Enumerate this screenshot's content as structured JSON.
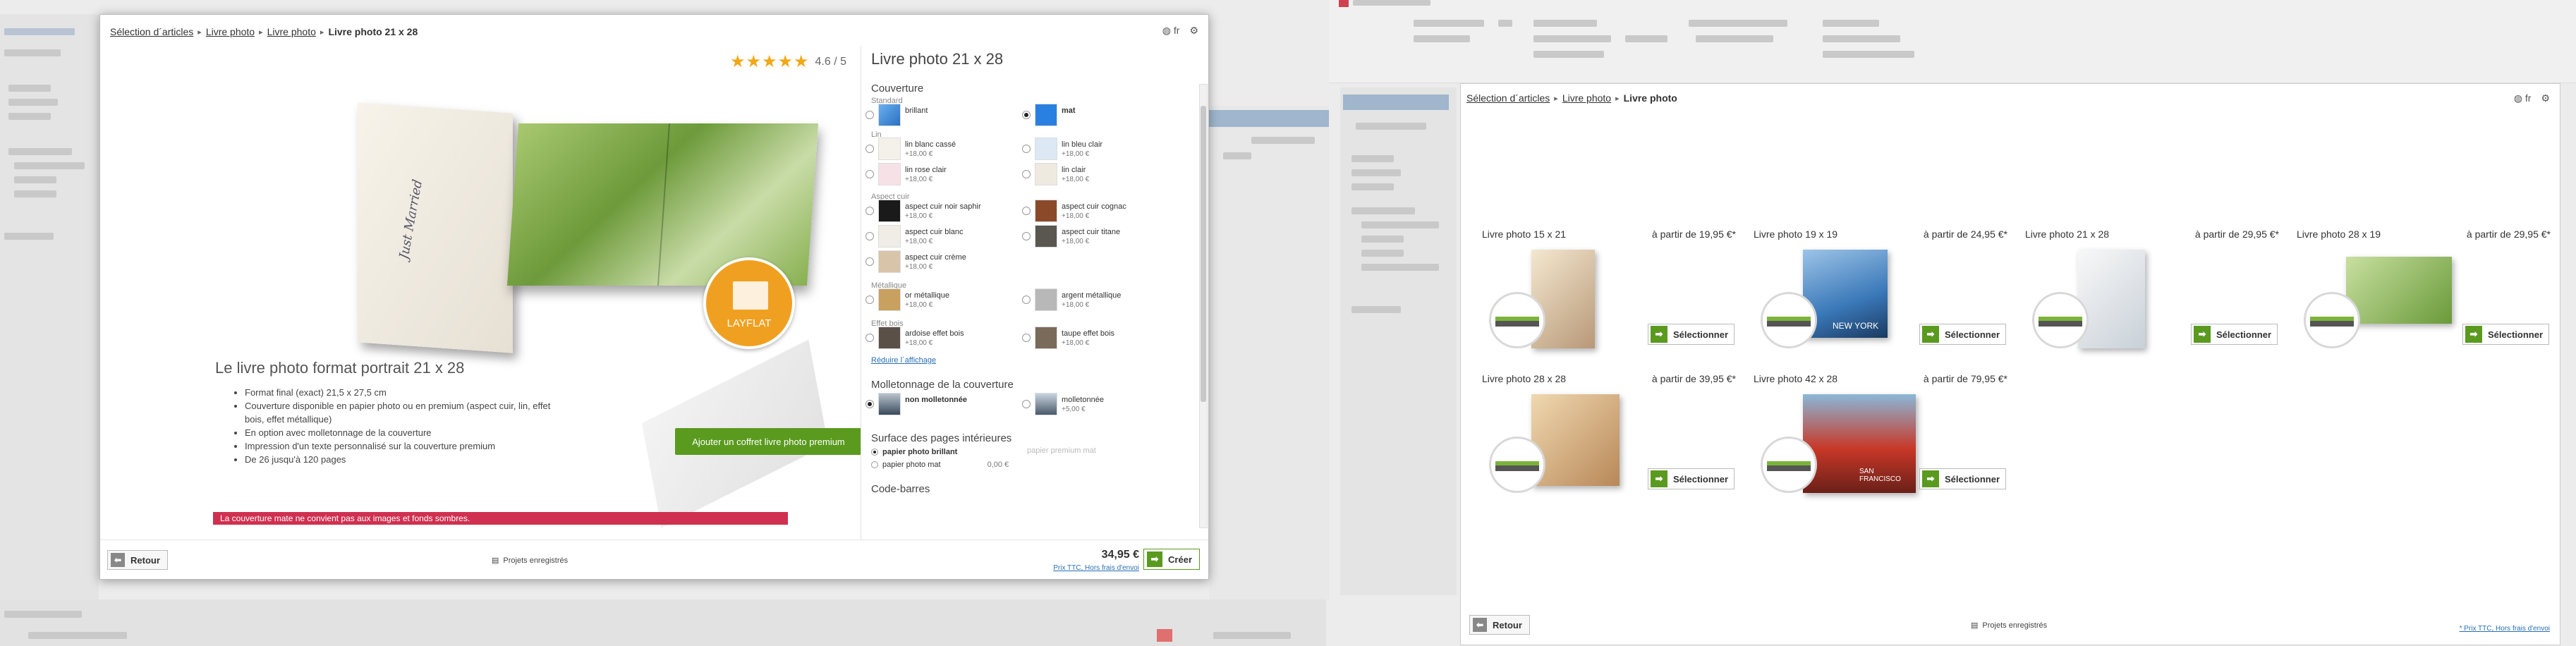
{
  "left_window": {
    "breadcrumb": [
      "Sélection d´articles",
      "Livre photo",
      "Livre photo",
      "Livre photo 21 x 28"
    ],
    "language": "fr",
    "rating": {
      "value": 4.6,
      "label": "4.6 / 5",
      "stars": "★★★★★"
    },
    "product_title": "Livre photo 21 x 28",
    "cover_script": "Just Married",
    "layflat_label": "LAYFLAT",
    "feature_title": "Le livre photo format portrait 21 x 28",
    "features": [
      "Format final  (exact) 21,5 x 27,5 cm",
      "Couverture disponible en papier photo ou en premium (aspect cuir, lin, effet bois, effet métallique)",
      "En option avec molletonnage de la couverture",
      "Impression d'un texte personnalisé sur la couverture premium",
      "De 26 jusqu'à 120 pages"
    ],
    "premium_box_button": "Ajouter un coffret livre photo premium",
    "alert": "La couverture mate ne convient pas aux images et fonds sombres.",
    "cover": {
      "title": "Couverture",
      "groups": [
        {
          "label": "Standard",
          "options": [
            {
              "name": "brillant",
              "price": "",
              "color": "#3a8ee0",
              "selected": false
            },
            {
              "name": "mat",
              "price": "",
              "color": "#2a80e0",
              "selected": true
            }
          ]
        },
        {
          "label": "Lin",
          "options": [
            {
              "name": "lin blanc cassé",
              "price": "+18,00 €",
              "color": "#f4f0ea",
              "selected": false
            },
            {
              "name": "lin bleu clair",
              "price": "+18,00 €",
              "color": "#dce8f4",
              "selected": false
            },
            {
              "name": "lin rose clair",
              "price": "+18,00 €",
              "color": "#f6e2e6",
              "selected": false
            },
            {
              "name": "lin clair",
              "price": "+18,00 €",
              "color": "#efeae0",
              "selected": false
            }
          ]
        },
        {
          "label": "Aspect cuir",
          "options": [
            {
              "name": "aspect cuir noir saphir",
              "price": "+18,00 €",
              "color": "#1a1a1a",
              "selected": false
            },
            {
              "name": "aspect cuir cognac",
              "price": "+18,00 €",
              "color": "#8a4a2a",
              "selected": false
            },
            {
              "name": "aspect cuir blanc",
              "price": "+18,00 €",
              "color": "#f0ece6",
              "selected": false
            },
            {
              "name": "aspect cuir titane",
              "price": "+18,00 €",
              "color": "#5a5650",
              "selected": false
            },
            {
              "name": "aspect cuir crème",
              "price": "+18,00 €",
              "color": "#d8c4a8",
              "selected": false
            }
          ]
        },
        {
          "label": "Métallique",
          "options": [
            {
              "name": "or métallique",
              "price": "+18,00 €",
              "color": "#c8a060",
              "selected": false
            },
            {
              "name": "argent métallique",
              "price": "+18,00 €",
              "color": "#b8b8b8",
              "selected": false
            }
          ]
        },
        {
          "label": "Effet bois",
          "options": [
            {
              "name": "ardoise effet bois",
              "price": "+18,00 €",
              "color": "#5a5048",
              "selected": false
            },
            {
              "name": "taupe effet bois",
              "price": "+18,00 €",
              "color": "#7a6a5a",
              "selected": false
            }
          ]
        }
      ],
      "reduce_link": "Réduire l´affichage"
    },
    "padding": {
      "title": "Molletonnage de la couverture",
      "options": [
        {
          "name": "non molletonnée",
          "price": "",
          "selected": true
        },
        {
          "name": "molletonnée",
          "price": "+5,00 €",
          "selected": false
        }
      ]
    },
    "pages": {
      "title": "Surface des pages intérieures",
      "options": [
        {
          "name": "papier photo brillant",
          "price": "",
          "selected": true
        },
        {
          "name": "papier photo mat",
          "price": "0,00 €",
          "selected": false
        },
        {
          "name": "papier premium mat",
          "price": "",
          "selected": false
        }
      ]
    },
    "barcode_title": "Code-barres",
    "footer": {
      "back": "Retour",
      "saved_projects": "Projets enregistrés",
      "total": "34,95 €",
      "price_note": "Prix TTC, Hors frais d'envoi",
      "create": "Créer"
    }
  },
  "right_window": {
    "breadcrumb": [
      "Sélection d´articles",
      "Livre photo",
      "Livre photo"
    ],
    "language": "fr",
    "products": [
      {
        "name": "Livre photo 15 x 21",
        "price": "à partir de 19,95 €*",
        "button": "Sélectionner",
        "color": "#d8c8a8"
      },
      {
        "name": "Livre photo 19 x 19",
        "price": "à partir de 24,95 €*",
        "button": "Sélectionner",
        "color": "#3a78b8",
        "cover_text": "NEW YORK"
      },
      {
        "name": "Livre photo 21 x 28",
        "price": "à partir de 29,95 €*",
        "button": "Sélectionner",
        "color": "#e8ecf0"
      },
      {
        "name": "Livre photo 28 x 19",
        "price": "à partir de 29,95 €*",
        "button": "Sélectionner",
        "color": "#8cb850"
      },
      {
        "name": "Livre photo 28 x 28",
        "price": "à partir de 39,95 €*",
        "button": "Sélectionner",
        "color": "#c8a070"
      },
      {
        "name": "Livre photo 42 x 28",
        "price": "à partir de 79,95 €*",
        "button": "Sélectionner",
        "color": "#c83828",
        "cover_text": "SAN FRANCISCO"
      }
    ],
    "footer": {
      "back": "Retour",
      "saved_projects": "Projets enregistrés",
      "price_note": "* Prix TTC, Hors frais d'envoi"
    }
  }
}
